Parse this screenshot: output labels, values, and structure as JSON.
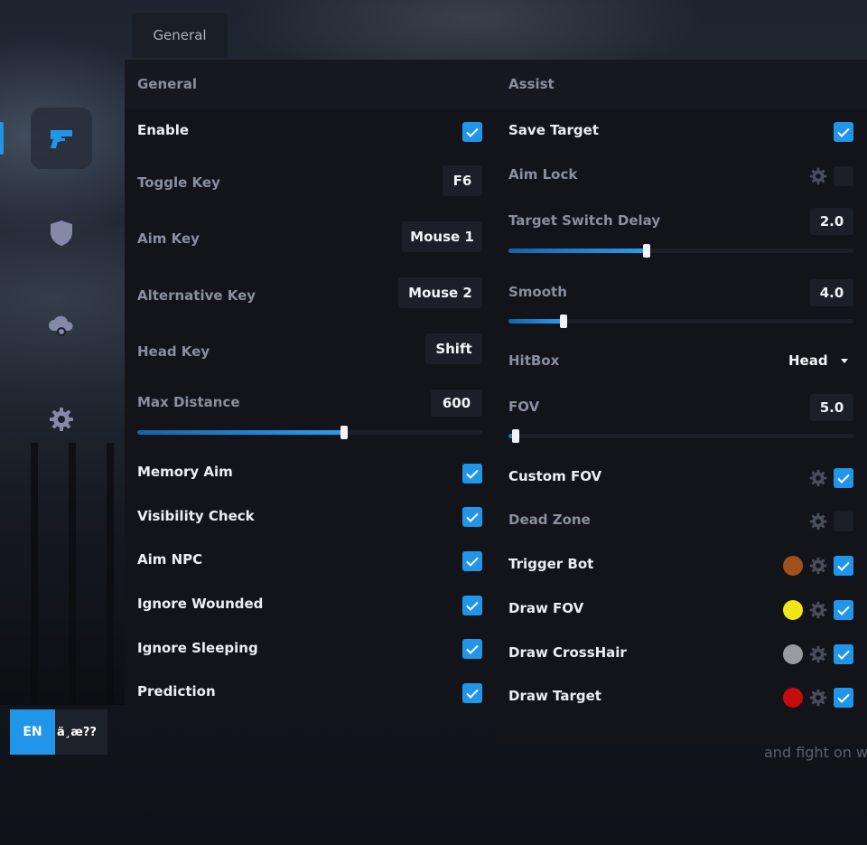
{
  "header": {
    "tab_label": "General"
  },
  "language": {
    "active": "EN",
    "other": "ä¸­æ??"
  },
  "sidebar": {
    "items": [
      {
        "name": "aim",
        "icon": "gun-icon",
        "active": true
      },
      {
        "name": "visuals",
        "icon": "shield-icon",
        "active": false
      },
      {
        "name": "misc",
        "icon": "cloud-icon",
        "active": false
      },
      {
        "name": "settings",
        "icon": "gear-icon",
        "active": false
      }
    ]
  },
  "general": {
    "title": "General",
    "enable": {
      "label": "Enable",
      "checked": true
    },
    "toggle_key": {
      "label": "Toggle Key",
      "value": "F6"
    },
    "aim_key": {
      "label": "Aim Key",
      "value": "Mouse 1"
    },
    "alternative_key": {
      "label": "Alternative Key",
      "value": "Mouse 2"
    },
    "head_key": {
      "label": "Head Key",
      "value": "Shift"
    },
    "max_distance": {
      "label": "Max Distance",
      "value": "600",
      "fraction": 0.6
    },
    "memory_aim": {
      "label": "Memory Aim",
      "checked": true
    },
    "visibility_check": {
      "label": "Visibility Check",
      "checked": true
    },
    "aim_npc": {
      "label": "Aim NPC",
      "checked": true
    },
    "ignore_wounded": {
      "label": "Ignore Wounded",
      "checked": true
    },
    "ignore_sleeping": {
      "label": "Ignore Sleeping",
      "checked": true
    },
    "prediction": {
      "label": "Prediction",
      "checked": true
    }
  },
  "assist": {
    "title": "Assist",
    "save_target": {
      "label": "Save Target",
      "checked": true
    },
    "aim_lock": {
      "label": "Aim Lock",
      "checked": false
    },
    "target_switch_delay": {
      "label": "Target Switch Delay",
      "value": "2.0",
      "fraction": 0.4
    },
    "smooth": {
      "label": "Smooth",
      "value": "4.0",
      "fraction": 0.16
    },
    "hitbox": {
      "label": "HitBox",
      "value": "Head"
    },
    "fov": {
      "label": "FOV",
      "value": "5.0",
      "fraction": 0.02
    },
    "custom_fov": {
      "label": "Custom FOV",
      "checked": true
    },
    "dead_zone": {
      "label": "Dead Zone",
      "checked": false
    },
    "trigger_bot": {
      "label": "Trigger Bot",
      "checked": true,
      "color": "#a0501a"
    },
    "draw_fov": {
      "label": "Draw FOV",
      "checked": true,
      "color": "#f0e619"
    },
    "draw_crosshair": {
      "label": "Draw CrossHair",
      "checked": true,
      "color": "#9a9ba0"
    },
    "draw_target": {
      "label": "Draw Target",
      "checked": true,
      "color": "#c40d0d"
    }
  },
  "background": {
    "caption": "and fight on w"
  },
  "colors": {
    "accent": "#2196e8",
    "panel": "#121419",
    "muted_text": "#8a8fa0"
  }
}
